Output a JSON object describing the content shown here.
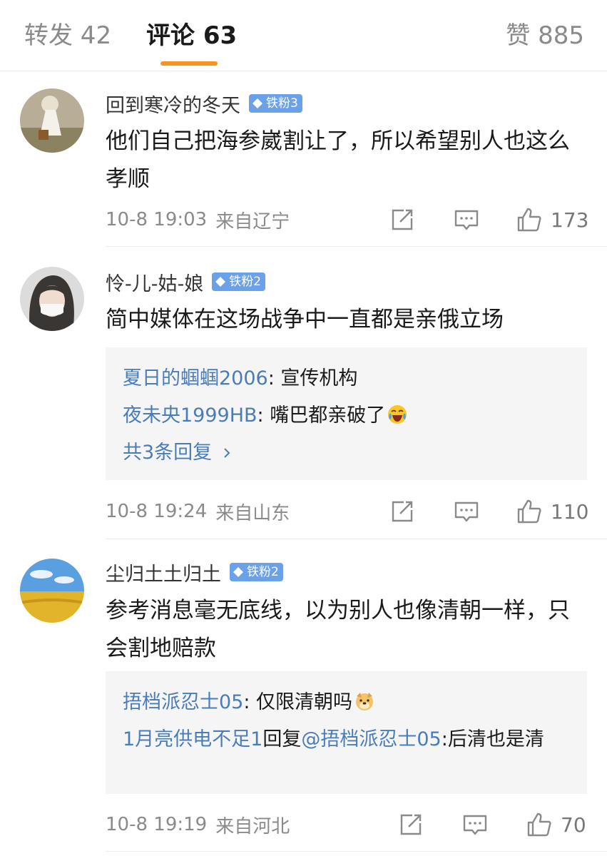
{
  "tabs": {
    "repost": "转发 42",
    "comments": "评论 63",
    "likes": "赞 885",
    "active": "comments",
    "accent_color": "#f7931e"
  },
  "colors": {
    "link": "#4a7db8",
    "badge": "#6aa1e8",
    "muted": "#8a8a8a"
  },
  "comments": [
    {
      "username": "回到寒冷的冬天",
      "badge": "铁粉3",
      "text": "他们自己把海参崴割让了，所以希望别人也这么孝顺",
      "time": "10-8 19:03",
      "location": "来自辽宁",
      "likes": "173",
      "replies": []
    },
    {
      "username": "怜-儿-姑-娘",
      "badge": "铁粉2",
      "text": "简中媒体在这场战争中一直都是亲俄立场",
      "time": "10-8 19:24",
      "location": "来自山东",
      "likes": "110",
      "replies": [
        {
          "user": "夏日的蝈蝈2006",
          "text": ": 宣传机构"
        },
        {
          "user": "夜未央1999HB",
          "text": ": 嘴巴都亲破了",
          "emoji": "laughing-crying-emoji"
        }
      ],
      "more_replies": "共3条回复"
    },
    {
      "username": "尘归土土归土",
      "badge": "铁粉2",
      "text": "参考消息毫无底线，以为别人也像清朝一样，只会割地赔款",
      "time": "10-8 19:19",
      "location": "来自河北",
      "likes": "70",
      "replies": [
        {
          "user": "捂档派忍士05",
          "text": ": 仅限清朝吗",
          "emoji": "doge-emoji"
        },
        {
          "user": "1月亮供电不足1",
          "text": "回复",
          "mention": "@捂档派忍士05",
          "after": ":后清也是清"
        }
      ]
    }
  ]
}
